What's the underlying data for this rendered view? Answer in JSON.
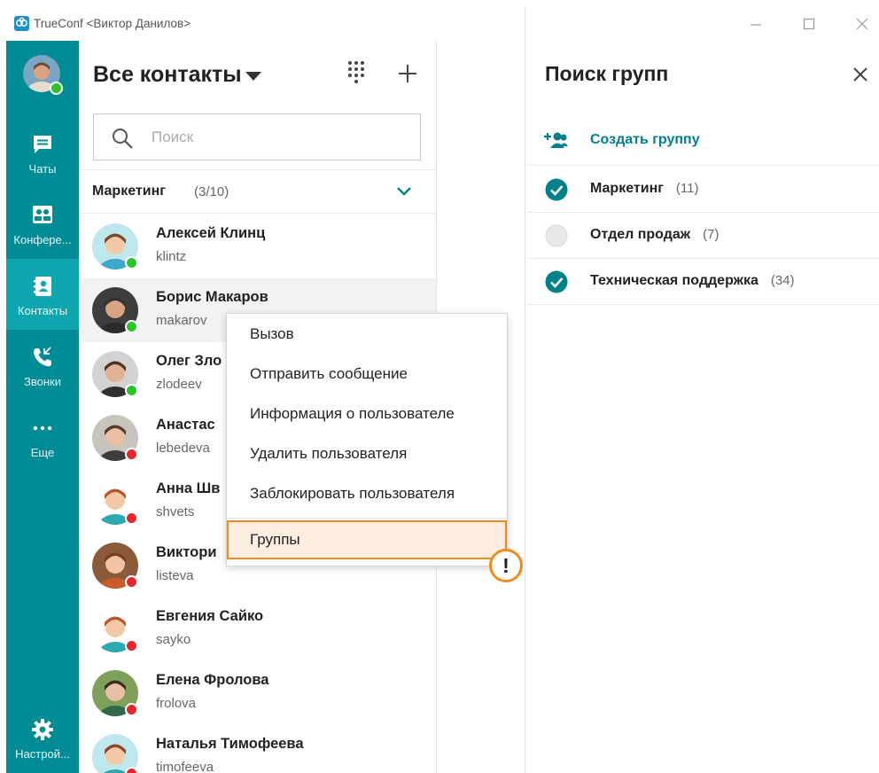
{
  "window": {
    "title": "TrueConf <Виктор Данилов>"
  },
  "rail": {
    "items": [
      {
        "label": "Чаты",
        "icon": "chat-icon"
      },
      {
        "label": "Конфере...",
        "icon": "conference-icon"
      },
      {
        "label": "Контакты",
        "icon": "contacts-icon",
        "active": true
      },
      {
        "label": "Звонки",
        "icon": "calls-icon"
      },
      {
        "label": "Еще",
        "icon": "more-icon"
      },
      {
        "label": "Настрой...",
        "icon": "settings-icon"
      }
    ],
    "user_status": "online"
  },
  "contacts": {
    "title": "Все контакты",
    "search_placeholder": "Поиск",
    "group": {
      "name": "Маркетинг",
      "count": "(3/10)"
    },
    "list": [
      {
        "name": "Алексей Клинц",
        "login": "klintz",
        "status": "online"
      },
      {
        "name": "Борис Макаров",
        "login": "makarov",
        "status": "online"
      },
      {
        "name": "Олег Зло",
        "login": "zlodeev",
        "status": "online"
      },
      {
        "name": "Анастас",
        "login": "lebedeva",
        "status": "offline"
      },
      {
        "name": "Анна Шв",
        "login": "shvets",
        "status": "offline"
      },
      {
        "name": "Виктори",
        "login": "listeva",
        "status": "offline"
      },
      {
        "name": "Евгения Сайко",
        "login": "sayko",
        "status": "offline"
      },
      {
        "name": "Елена Фролова",
        "login": "frolova",
        "status": "offline"
      },
      {
        "name": "Наталья Тимофеева",
        "login": "timofeeva",
        "status": "offline"
      }
    ]
  },
  "context_menu": {
    "items": [
      "Вызов",
      "Отправить сообщение",
      "Информация о пользователе",
      "Удалить пользователя",
      "Заблокировать пользователя",
      "Группы"
    ],
    "highlighted": "Группы",
    "badge": "!"
  },
  "group_search": {
    "title": "Поиск групп",
    "create_label": "Создать группу",
    "groups": [
      {
        "name": "Маркетинг",
        "count": "(11)",
        "checked": true
      },
      {
        "name": "Отдел продаж",
        "count": "(7)",
        "checked": false
      },
      {
        "name": "Техническая поддержка",
        "count": "(34)",
        "checked": true
      }
    ]
  },
  "colors": {
    "rail": "#008b95",
    "rail_active": "#10a6b0",
    "accent": "#00808a",
    "online": "#2bc52b",
    "offline": "#e8262b",
    "highlight_border": "#f08a1e"
  }
}
